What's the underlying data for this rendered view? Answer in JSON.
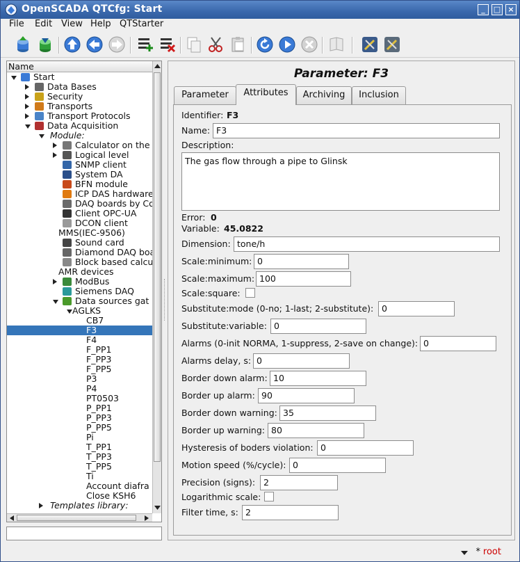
{
  "window": {
    "title": "OpenSCADA QTCfg: Start"
  },
  "menu": [
    "File",
    "Edit",
    "View",
    "Help",
    "QTStarter"
  ],
  "tree": {
    "header": "Name",
    "rows": [
      {
        "label": "Start",
        "level": 0,
        "exp": "d",
        "icon": "start-icon",
        "color": "#3a7ad6"
      },
      {
        "label": "Data Bases",
        "level": 1,
        "exp": "r",
        "icon": "database-icon",
        "color": "#666"
      },
      {
        "label": "Security",
        "level": 1,
        "exp": "r",
        "icon": "key-icon",
        "color": "#c9a21a"
      },
      {
        "label": "Transports",
        "level": 1,
        "exp": "r",
        "icon": "transport-icon",
        "color": "#d07a1a"
      },
      {
        "label": "Transport Protocols",
        "level": 1,
        "exp": "r",
        "icon": "folder-icon",
        "color": "#4a84c8"
      },
      {
        "label": "Data Acquisition",
        "level": 1,
        "exp": "d",
        "icon": "graph-icon",
        "color": "#b03030"
      },
      {
        "label": "Module:",
        "level": 2,
        "exp": "d",
        "icon": "",
        "italic": true
      },
      {
        "label": "Calculator on the",
        "level": 3,
        "exp": "r",
        "icon": "calculator-icon",
        "color": "#777"
      },
      {
        "label": "Logical level",
        "level": 3,
        "exp": "r",
        "icon": "logic-icon",
        "color": "#555"
      },
      {
        "label": "SNMP client",
        "level": 3,
        "exp": "",
        "icon": "snmp-icon",
        "color": "#3466a8"
      },
      {
        "label": "System DA",
        "level": 3,
        "exp": "",
        "icon": "system-icon",
        "color": "#2a4f8a"
      },
      {
        "label": "BFN module",
        "level": 3,
        "exp": "",
        "icon": "bfn-icon",
        "color": "#c84a1a"
      },
      {
        "label": "ICP DAS hardware",
        "level": 3,
        "exp": "",
        "icon": "icpdas-icon",
        "color": "#e07a10"
      },
      {
        "label": "DAQ boards by Co",
        "level": 3,
        "exp": "",
        "icon": "daq-board-icon",
        "color": "#6a6a6a"
      },
      {
        "label": "Client OPC-UA",
        "level": 3,
        "exp": "",
        "icon": "opcua-icon",
        "color": "#333"
      },
      {
        "label": "DCON client",
        "level": 3,
        "exp": "",
        "icon": "dcon-icon",
        "color": "#999"
      },
      {
        "label": "MMS(IEC-9506)",
        "level": 3,
        "exp": "",
        "icon": "",
        "noicon": true
      },
      {
        "label": "Sound card",
        "level": 3,
        "exp": "",
        "icon": "microphone-icon",
        "color": "#444"
      },
      {
        "label": "Diamond DAQ boa",
        "level": 3,
        "exp": "",
        "icon": "diamond-icon",
        "color": "#666"
      },
      {
        "label": "Block based calcu",
        "level": 3,
        "exp": "",
        "icon": "block-icon",
        "color": "#888"
      },
      {
        "label": "AMR devices",
        "level": 3,
        "exp": "",
        "icon": "",
        "noicon": true
      },
      {
        "label": "ModBus",
        "level": 3,
        "exp": "r",
        "icon": "modbus-icon",
        "color": "#3a8a3a"
      },
      {
        "label": "Siemens DAQ",
        "level": 3,
        "exp": "",
        "icon": "siemens-icon",
        "color": "#2a9a9a"
      },
      {
        "label": "Data sources gat",
        "level": 3,
        "exp": "d",
        "icon": "gateway-icon",
        "color": "#4a9a2a"
      },
      {
        "label": "AGLKS",
        "level": 4,
        "exp": "d",
        "icon": "",
        "noicon": true
      },
      {
        "label": "CB7",
        "level": 5,
        "exp": "",
        "icon": "",
        "noicon": true
      },
      {
        "label": "F3",
        "level": 5,
        "exp": "",
        "icon": "",
        "noicon": true,
        "selected": true
      },
      {
        "label": "F4",
        "level": 5,
        "exp": "",
        "icon": "",
        "noicon": true
      },
      {
        "label": "F_PP1",
        "level": 5,
        "exp": "",
        "icon": "",
        "noicon": true
      },
      {
        "label": "F_PP3",
        "level": 5,
        "exp": "",
        "icon": "",
        "noicon": true
      },
      {
        "label": "F_PP5",
        "level": 5,
        "exp": "",
        "icon": "",
        "noicon": true
      },
      {
        "label": "P3",
        "level": 5,
        "exp": "",
        "icon": "",
        "noicon": true
      },
      {
        "label": "P4",
        "level": 5,
        "exp": "",
        "icon": "",
        "noicon": true
      },
      {
        "label": "PT0503",
        "level": 5,
        "exp": "",
        "icon": "",
        "noicon": true
      },
      {
        "label": "P_PP1",
        "level": 5,
        "exp": "",
        "icon": "",
        "noicon": true
      },
      {
        "label": "P_PP3",
        "level": 5,
        "exp": "",
        "icon": "",
        "noicon": true
      },
      {
        "label": "P_PP5",
        "level": 5,
        "exp": "",
        "icon": "",
        "noicon": true
      },
      {
        "label": "Pi",
        "level": 5,
        "exp": "",
        "icon": "",
        "noicon": true
      },
      {
        "label": "T_PP1",
        "level": 5,
        "exp": "",
        "icon": "",
        "noicon": true
      },
      {
        "label": "T_PP3",
        "level": 5,
        "exp": "",
        "icon": "",
        "noicon": true
      },
      {
        "label": "T_PP5",
        "level": 5,
        "exp": "",
        "icon": "",
        "noicon": true
      },
      {
        "label": "Ti",
        "level": 5,
        "exp": "",
        "icon": "",
        "noicon": true
      },
      {
        "label": "Account diafra",
        "level": 5,
        "exp": "",
        "icon": "",
        "noicon": true
      },
      {
        "label": "Close KSH6",
        "level": 5,
        "exp": "",
        "icon": "",
        "noicon": true
      },
      {
        "label": "Templates library:",
        "level": 2,
        "exp": "r",
        "icon": "",
        "italic": true
      }
    ]
  },
  "panel": {
    "title": "Parameter: F3",
    "tabs": [
      "Parameter",
      "Attributes",
      "Archiving",
      "Inclusion"
    ],
    "active_tab": 1,
    "identifier_label": "Identifier:",
    "identifier_value": "F3",
    "name_label": "Name:",
    "name_value": "F3",
    "description_label": "Description:",
    "description_value": "The gas flow through a pipe to Glinsk",
    "error_label": "Error:",
    "error_value": "0",
    "variable_label": "Variable:",
    "variable_value": "45.0822",
    "dimension_label": "Dimension:",
    "dimension_value": "tone/h",
    "scale_min_label": "Scale:minimum:",
    "scale_min_value": "0",
    "scale_max_label": "Scale:maximum:",
    "scale_max_value": "100",
    "scale_square_label": "Scale:square:",
    "subst_mode_label": "Substitute:mode (0-no; 1-last; 2-substitute):",
    "subst_mode_value": "0",
    "subst_var_label": "Substitute:variable:",
    "subst_var_value": "0",
    "alarms_label": "Alarms (0-init NORMA, 1-suppress, 2-save on change):",
    "alarms_value": "0",
    "alarms_delay_label": "Alarms delay, s:",
    "alarms_delay_value": "0",
    "border_down_alarm_label": "Border down alarm:",
    "border_down_alarm_value": "10",
    "border_up_alarm_label": "Border up alarm:",
    "border_up_alarm_value": "90",
    "border_down_warning_label": "Border down warning:",
    "border_down_warning_value": "35",
    "border_up_warning_label": "Border up warning:",
    "border_up_warning_value": "80",
    "hysteresis_label": "Hysteresis of boders violation:",
    "hysteresis_value": "0",
    "motion_label": "Motion speed (%/cycle):",
    "motion_value": "0",
    "precision_label": "Precision (signs):",
    "precision_value": "2",
    "logscale_label": "Logarithmic scale:",
    "filter_label": "Filter time, s:",
    "filter_value": "2"
  },
  "status": {
    "modified": "*",
    "user": "root"
  },
  "colors": {
    "accent": "#3475b9",
    "user": "#cc0000",
    "title_bar": "#3c6aae"
  }
}
